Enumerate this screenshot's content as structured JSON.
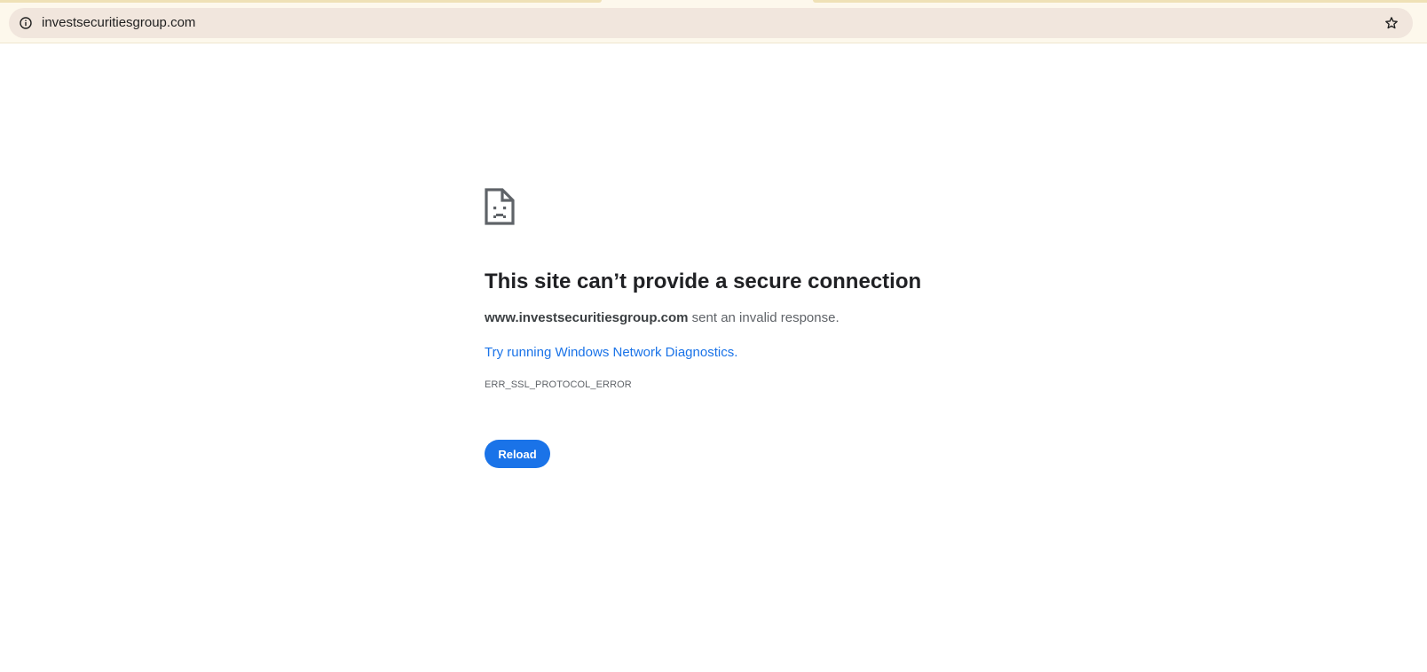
{
  "browser": {
    "omnibox": {
      "url": "investsecuritiesgroup.com",
      "site_info_icon": "info-circle-icon",
      "bookmark_icon": "star-outline-icon"
    }
  },
  "error_page": {
    "icon": "sad-page-icon",
    "title": "This site can’t provide a secure connection",
    "summary_domain": "www.investsecuritiesgroup.com",
    "summary_rest": " sent an invalid response.",
    "diagnostics_link": "Try running Windows Network Diagnostics.",
    "error_code": "ERR_SSL_PROTOCOL_ERROR",
    "reload_label": "Reload"
  },
  "colors": {
    "chrome_bg": "#fdf8ec",
    "omnibox_bg": "#f1e6dd",
    "link": "#1a73e8",
    "button_bg": "#1a73e8",
    "title": "#202124",
    "secondary_text": "#5f6368"
  }
}
